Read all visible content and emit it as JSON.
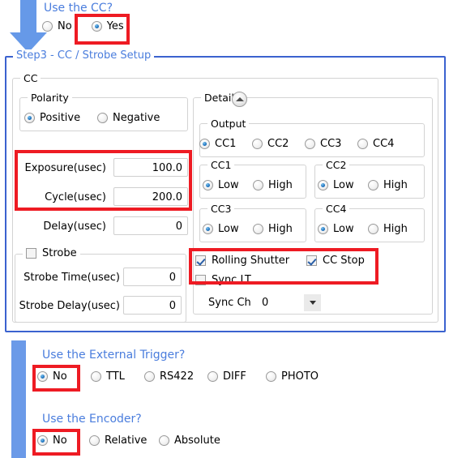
{
  "arrow": {
    "name": "down-arrow",
    "color": "#6699e8"
  },
  "questions": {
    "cc": {
      "label": "Use the CC?",
      "options": [
        {
          "label": "No",
          "selected": false
        },
        {
          "label": "Yes",
          "selected": true
        }
      ]
    },
    "external_trigger": {
      "label": "Use the External Trigger?",
      "options": [
        {
          "label": "No",
          "selected": true
        },
        {
          "label": "TTL",
          "selected": false
        },
        {
          "label": "RS422",
          "selected": false
        },
        {
          "label": "DIFF",
          "selected": false
        },
        {
          "label": "PHOTO",
          "selected": false
        }
      ]
    },
    "encoder": {
      "label": "Use the Encoder?",
      "options": [
        {
          "label": "No",
          "selected": true
        },
        {
          "label": "Relative",
          "selected": false
        },
        {
          "label": "Absolute",
          "selected": false
        }
      ]
    }
  },
  "step3": {
    "title": "Step3 - CC / Strobe Setup",
    "cc_group_title": "CC",
    "polarity": {
      "title": "Polarity",
      "options": [
        {
          "label": "Positive",
          "selected": true
        },
        {
          "label": "Negative",
          "selected": false
        }
      ]
    },
    "timing_fields": [
      {
        "label": "Exposure(usec)",
        "value": "100.0"
      },
      {
        "label": "Cycle(usec)",
        "value": "200.0"
      },
      {
        "label": "Delay(usec)",
        "value": "0"
      }
    ],
    "strobe": {
      "title": "Strobe",
      "checked": false,
      "fields": [
        {
          "label": "Strobe Time(usec)",
          "value": "0"
        },
        {
          "label": "Strobe Delay(usec)",
          "value": "0"
        }
      ]
    },
    "detail": {
      "title": "Detail",
      "collapse_icon": "chevron-up-icon",
      "output": {
        "title": "Output",
        "options": [
          {
            "label": "CC1",
            "selected": true
          },
          {
            "label": "CC2",
            "selected": false
          },
          {
            "label": "CC3",
            "selected": false
          },
          {
            "label": "CC4",
            "selected": false
          }
        ]
      },
      "levels": [
        {
          "title": "CC1",
          "options": [
            {
              "label": "Low",
              "selected": true
            },
            {
              "label": "High",
              "selected": false
            }
          ]
        },
        {
          "title": "CC2",
          "options": [
            {
              "label": "Low",
              "selected": true
            },
            {
              "label": "High",
              "selected": false
            }
          ]
        },
        {
          "title": "CC3",
          "options": [
            {
              "label": "Low",
              "selected": true
            },
            {
              "label": "High",
              "selected": false
            }
          ]
        },
        {
          "title": "CC4",
          "options": [
            {
              "label": "Low",
              "selected": true
            },
            {
              "label": "High",
              "selected": false
            }
          ]
        }
      ],
      "checkboxes": [
        {
          "label": "Rolling Shutter",
          "checked": true
        },
        {
          "label": "CC Stop",
          "checked": true
        },
        {
          "label": "Sync LT",
          "checked": false
        }
      ],
      "sync_ch": {
        "label": "Sync Ch",
        "value": "0"
      }
    }
  },
  "highlights": {
    "color": "#ee1b23"
  }
}
